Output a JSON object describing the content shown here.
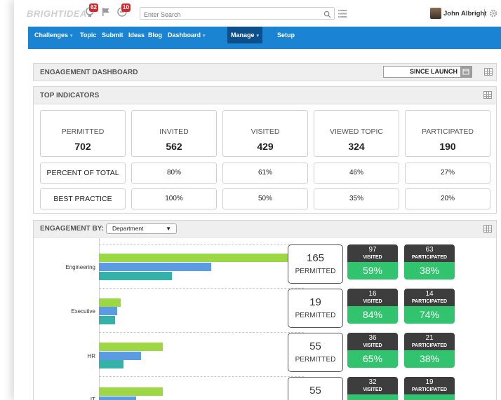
{
  "header": {
    "logo": "BRIGHTIDEA",
    "badges": [
      "62",
      "10"
    ],
    "search_placeholder": "Enter Search",
    "user_name": "John Albright"
  },
  "nav": {
    "items": [
      {
        "label": "Challenges",
        "dropdown": true
      },
      {
        "label": "Topic",
        "dropdown": false
      },
      {
        "label": "Submit",
        "dropdown": false
      },
      {
        "label": "Ideas",
        "dropdown": false
      },
      {
        "label": "Blog",
        "dropdown": false
      },
      {
        "label": "Dashboard",
        "dropdown": true
      },
      {
        "label": "Manage",
        "dropdown": true,
        "active": true
      },
      {
        "label": "Setup",
        "dropdown": false
      }
    ]
  },
  "dashboard": {
    "title": "ENGAGEMENT DASHBOARD",
    "range": "SINCE LAUNCH"
  },
  "top_indicators": {
    "title": "TOP INDICATORS",
    "cards": [
      {
        "label": "PERMITTED",
        "value": "702"
      },
      {
        "label": "INVITED",
        "value": "562"
      },
      {
        "label": "VISITED",
        "value": "429"
      },
      {
        "label": "VIEWED TOPIC",
        "value": "324"
      },
      {
        "label": "PARTICIPATED",
        "value": "190"
      }
    ],
    "percent_row": {
      "label": "PERCENT OF TOTAL",
      "values": [
        "80%",
        "61%",
        "46%",
        "27%"
      ]
    },
    "best_row": {
      "label": "BEST PRACTICE",
      "values": [
        "100%",
        "50%",
        "35%",
        "20%"
      ]
    }
  },
  "engagement_by": {
    "title": "ENGAGEMENT BY:",
    "selected": "Department",
    "permitted_label": "PERMITTED",
    "visited_label": "VISITED",
    "participated_label": "PARTICIPATED",
    "departments": [
      {
        "name": "Engineering",
        "permitted": "165",
        "visited": "97",
        "visited_pct": "59%",
        "participated": "63",
        "participated_pct": "38%"
      },
      {
        "name": "Executive",
        "permitted": "19",
        "visited": "16",
        "visited_pct": "84%",
        "participated": "14",
        "participated_pct": "74%"
      },
      {
        "name": "HR",
        "permitted": "55",
        "visited": "36",
        "visited_pct": "65%",
        "participated": "21",
        "participated_pct": "38%"
      },
      {
        "name": "IT",
        "permitted": "55",
        "visited": "32",
        "visited_pct": "",
        "participated": "19",
        "participated_pct": ""
      }
    ],
    "colors": {
      "permitted": "#9cd843",
      "visited": "#5b9be2",
      "participated": "#34b2a9"
    }
  }
}
